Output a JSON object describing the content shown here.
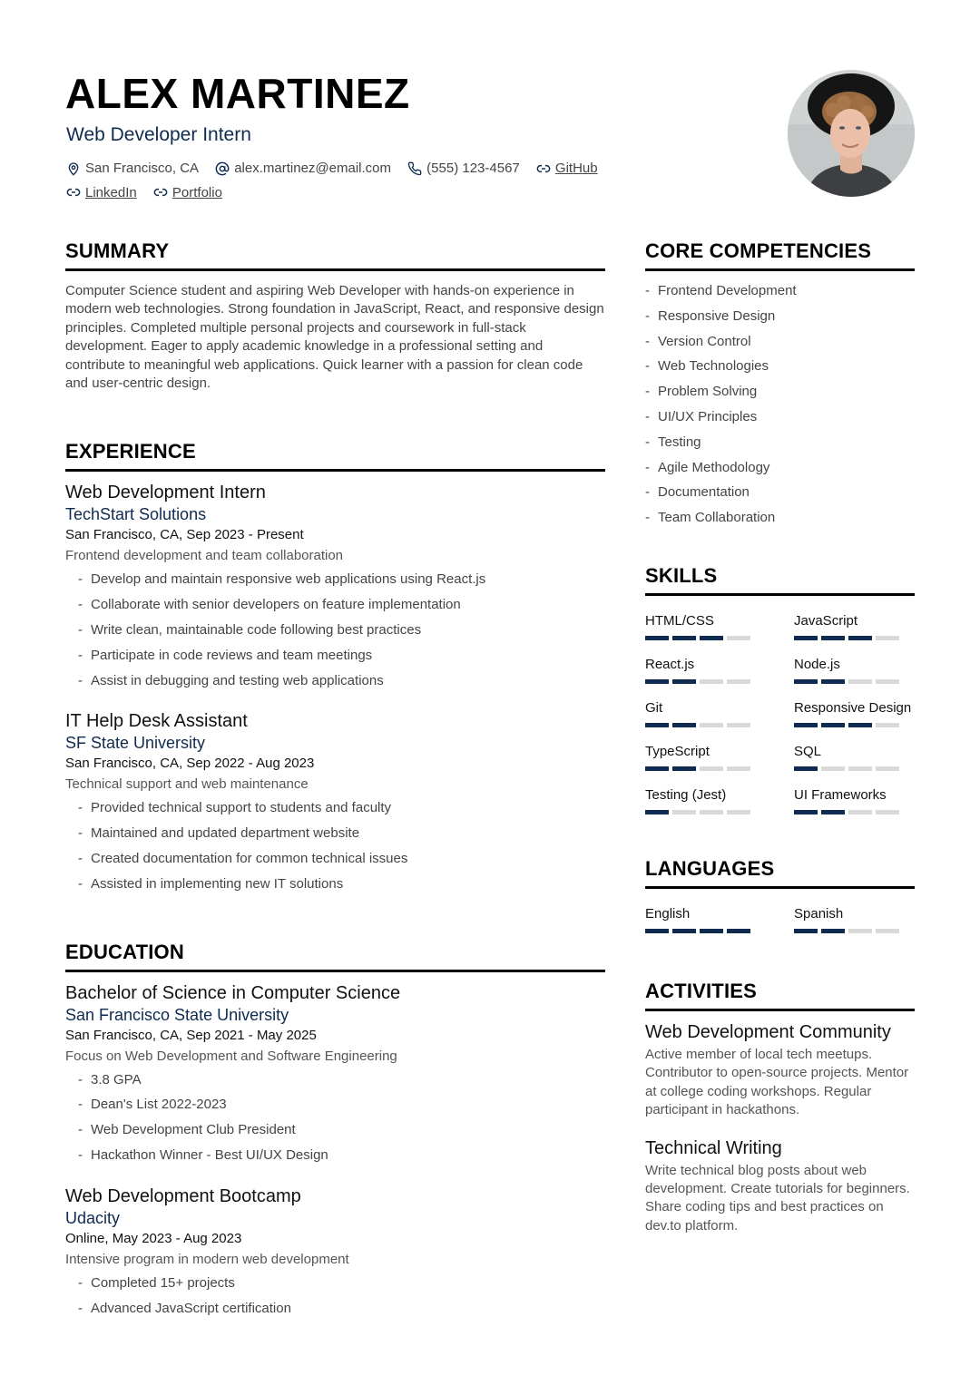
{
  "header": {
    "name": "ALEX MARTINEZ",
    "title": "Web Developer Intern",
    "contact": {
      "location": "San Francisco, CA",
      "email": "alex.martinez@email.com",
      "phone": "(555) 123-4567",
      "github": "GitHub",
      "linkedin": "LinkedIn",
      "portfolio": "Portfolio"
    },
    "icons": [
      "map-pin-icon",
      "at-sign-icon",
      "phone-icon",
      "link-icon"
    ],
    "accent_color": "#0f2b4f"
  },
  "summary": {
    "heading": "SUMMARY",
    "text": "Computer Science student and aspiring Web Developer with hands-on experience in modern web technologies. Strong foundation in JavaScript, React, and responsive design principles. Completed multiple personal projects and coursework in full-stack development. Eager to apply academic knowledge in a professional setting and contribute to meaningful web applications. Quick learner with a passion for clean code and user-centric design."
  },
  "experience": {
    "heading": "EXPERIENCE",
    "entries": [
      {
        "title": "Web Development Intern",
        "org": "TechStart Solutions",
        "meta": "San Francisco, CA, Sep 2023 - Present",
        "desc": "Frontend development and team collaboration",
        "bullets": [
          "Develop and maintain responsive web applications using React.js",
          "Collaborate with senior developers on feature implementation",
          "Write clean, maintainable code following best practices",
          "Participate in code reviews and team meetings",
          "Assist in debugging and testing web applications"
        ]
      },
      {
        "title": "IT Help Desk Assistant",
        "org": "SF State University",
        "meta": "San Francisco, CA, Sep 2022 - Aug 2023",
        "desc": "Technical support and web maintenance",
        "bullets": [
          "Provided technical support to students and faculty",
          "Maintained and updated department website",
          "Created documentation for common technical issues",
          "Assisted in implementing new IT solutions"
        ]
      }
    ]
  },
  "education": {
    "heading": "EDUCATION",
    "entries": [
      {
        "title": "Bachelor of Science in Computer Science",
        "org": "San Francisco State University",
        "meta": "San Francisco, CA, Sep 2021 - May 2025",
        "desc": "Focus on Web Development and Software Engineering",
        "bullets": [
          "3.8 GPA",
          "Dean's List 2022-2023",
          "Web Development Club President",
          "Hackathon Winner - Best UI/UX Design"
        ]
      },
      {
        "title": "Web Development Bootcamp",
        "org": "Udacity",
        "meta": "Online, May 2023 - Aug 2023",
        "desc": "Intensive program in modern web development",
        "bullets": [
          "Completed 15+ projects",
          "Advanced JavaScript certification"
        ]
      }
    ]
  },
  "competencies": {
    "heading": "CORE COMPETENCIES",
    "items": [
      "Frontend Development",
      "Responsive Design",
      "Version Control",
      "Web Technologies",
      "Problem Solving",
      "UI/UX Principles",
      "Testing",
      "Agile Methodology",
      "Documentation",
      "Team Collaboration"
    ]
  },
  "skills": {
    "heading": "SKILLS",
    "max_level": 4,
    "items": [
      {
        "name": "HTML/CSS",
        "level": 3
      },
      {
        "name": "JavaScript",
        "level": 3
      },
      {
        "name": "React.js",
        "level": 2
      },
      {
        "name": "Node.js",
        "level": 2
      },
      {
        "name": "Git",
        "level": 2
      },
      {
        "name": "Responsive Design",
        "level": 3
      },
      {
        "name": "TypeScript",
        "level": 2
      },
      {
        "name": "SQL",
        "level": 1
      },
      {
        "name": "Testing (Jest)",
        "level": 1
      },
      {
        "name": "UI Frameworks",
        "level": 2
      }
    ]
  },
  "languages": {
    "heading": "LANGUAGES",
    "max_level": 4,
    "items": [
      {
        "name": "English",
        "level": 4
      },
      {
        "name": "Spanish",
        "level": 2
      }
    ]
  },
  "activities": {
    "heading": "ACTIVITIES",
    "items": [
      {
        "title": "Web Development Community",
        "text": "Active member of local tech meetups. Contributor to open-source projects. Mentor at college coding workshops. Regular participant in hackathons."
      },
      {
        "title": "Technical Writing",
        "text": "Write technical blog posts about web development. Create tutorials for beginners. Share coding tips and best practices on dev.to platform."
      }
    ]
  }
}
